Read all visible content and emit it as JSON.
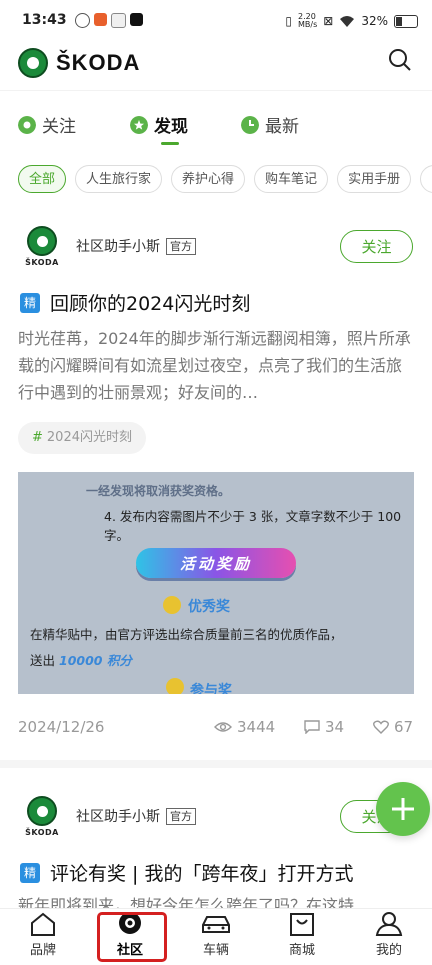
{
  "status_bar": {
    "time": "13:43",
    "net_speed": "2.20",
    "net_unit": "MB/s",
    "battery": "32%"
  },
  "header": {
    "brand": "ŠKODA"
  },
  "tabs": [
    {
      "label": "关注"
    },
    {
      "label": "发现",
      "active": true
    },
    {
      "label": "最新"
    }
  ],
  "chips": [
    "全部",
    "人生旅行家",
    "养护心得",
    "购车笔记",
    "实用手册"
  ],
  "post1": {
    "author": "社区助手小斯",
    "badge": "官方",
    "follow_label": "关注",
    "jing": "精",
    "title": "回顾你的2024闪光时刻",
    "excerpt": "时光荏苒，2024年的脚步渐行渐远翻阅相簿，照片所承载的闪耀瞬间有如流星划过夜空，点亮了我们的生活旅行中遇到的壮丽景观；好友间的…",
    "tag": "2024闪光时刻",
    "image": {
      "line1": "一经发现将取消获奖资格。",
      "line2": "4. 发布内容需图片不少于 3 张，文章字数不少于 100 字。",
      "reward_button": "活动奖励",
      "excellent": "优秀奖",
      "line3": "在精华贴中，由官方评选出综合质量前三名的优质作品，",
      "line4_prefix": "送出",
      "line4_points": "10000 积分",
      "participate": "参与奖"
    },
    "date": "2024/12/26",
    "views": "3444",
    "comments": "34",
    "likes": "67"
  },
  "post2": {
    "author": "社区助手小斯",
    "badge": "官方",
    "follow_label": "关注",
    "jing": "精",
    "title": "评论有奖 | 我的「跨年夜」打开方式",
    "excerpt": "新年即将到来，想好今年怎么跨年了吗？在这特"
  },
  "bottom_nav": [
    {
      "label": "品牌",
      "icon": "home-icon"
    },
    {
      "label": "社区",
      "icon": "community-icon",
      "active": true
    },
    {
      "label": "车辆",
      "icon": "car-icon"
    },
    {
      "label": "商城",
      "icon": "shop-icon"
    },
    {
      "label": "我的",
      "icon": "profile-icon"
    }
  ],
  "colors": {
    "accent": "#4ba82e",
    "fab": "#63c34d",
    "jing": "#2a8fe0",
    "highlight": "#d42020"
  }
}
